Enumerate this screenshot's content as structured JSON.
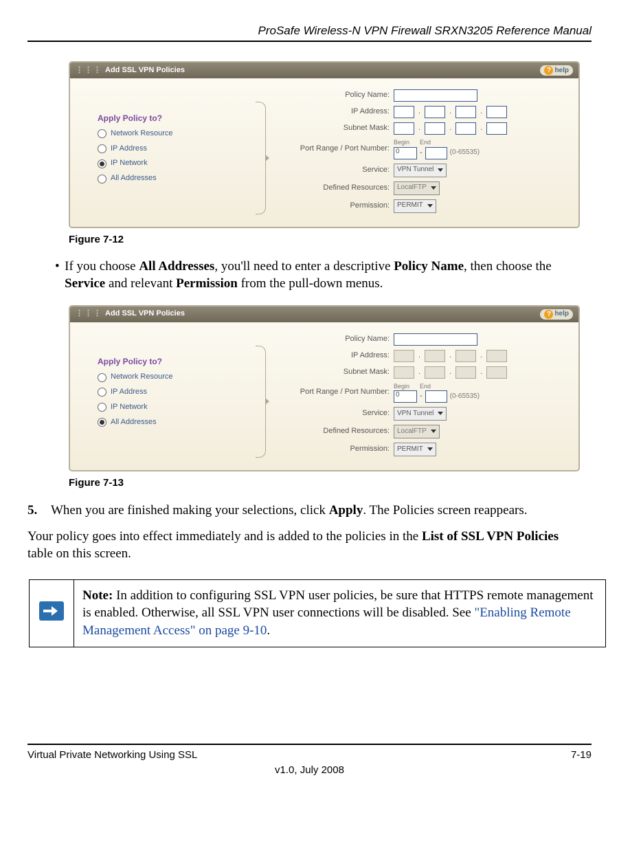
{
  "header": {
    "title": "ProSafe Wireless-N VPN Firewall SRXN3205 Reference Manual"
  },
  "panel_common": {
    "title": "Add SSL VPN Policies",
    "help": "help",
    "apply_heading": "Apply Policy to?",
    "radios": [
      "Network Resource",
      "IP Address",
      "IP Network",
      "All Addresses"
    ],
    "field_labels": {
      "policy_name": "Policy Name:",
      "ip_address": "IP Address:",
      "subnet_mask": "Subnet Mask:",
      "port_range": "Port Range / Port Number:",
      "begin": "Begin",
      "end": "End",
      "port_begin_value": "0",
      "range_hint": "(0-65535)",
      "service": "Service:",
      "service_value": "VPN Tunnel",
      "defined_resources": "Defined Resources:",
      "defined_value": "LocalFTP",
      "permission": "Permission:",
      "permission_value": "PERMIT"
    }
  },
  "figures": {
    "f12": "Figure 7-12",
    "f13": "Figure 7-13"
  },
  "text": {
    "bullet_all_addresses_1": "If you choose ",
    "b_all": "All Addresses",
    "bullet_all_addresses_2": ", you'll need to enter a descriptive ",
    "b_policy": "Policy Name",
    "bullet_all_addresses_3": ", then choose the ",
    "b_service": "Service",
    "bullet_all_addresses_4": " and relevant ",
    "b_permission": "Permission",
    "bullet_all_addresses_5": " from the pull-down menus.",
    "step5_num": "5.",
    "step5_a": "When you are finished making your selections, click ",
    "step5_b": "Apply",
    "step5_c": ".  The Policies screen reappears.",
    "para_a": "Your policy goes into effect immediately and is added to the policies in the ",
    "para_b": "List of SSL VPN Policies",
    "para_c": " table on this screen.",
    "note_label": "Note:",
    "note_body": " In addition to configuring SSL VPN user policies, be sure that HTTPS remote management is enabled. Otherwise, all SSL VPN user connections will be disabled. See ",
    "note_link": "\"Enabling Remote Management Access\" on page 9-10",
    "note_tail": "."
  },
  "footer": {
    "left": "Virtual Private Networking Using SSL",
    "right": "7-19",
    "center": "v1.0, July 2008"
  }
}
